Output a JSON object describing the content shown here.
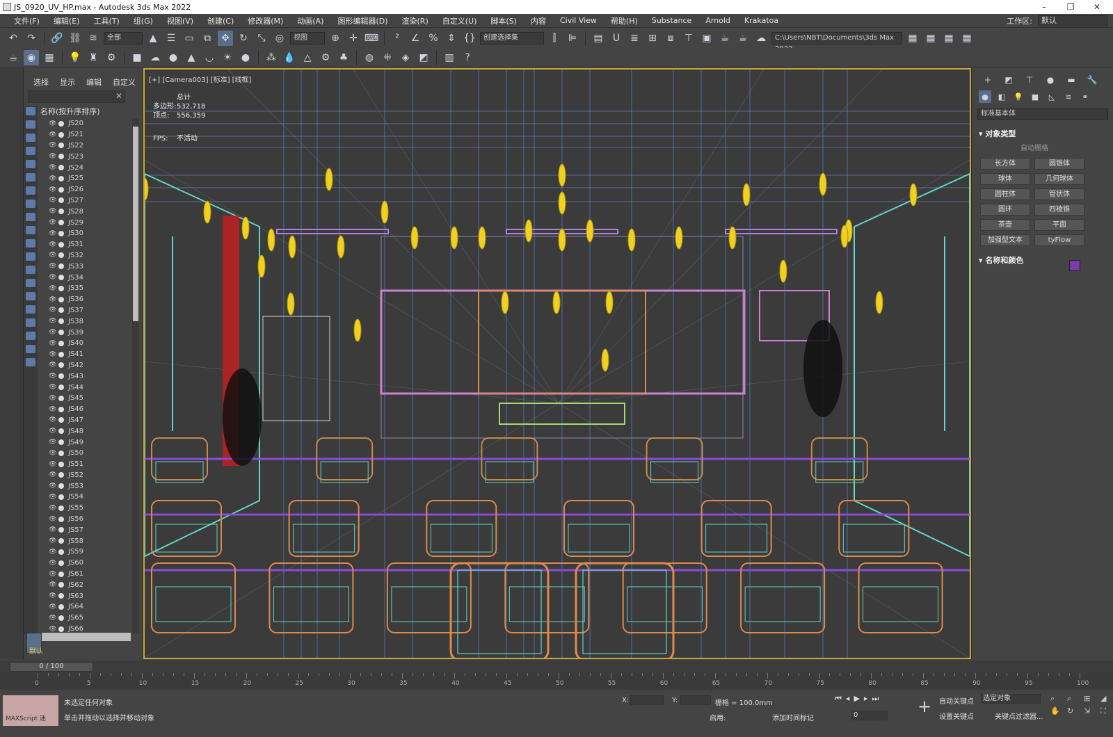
{
  "window": {
    "title": "JS_0920_UV_HP.max - Autodesk 3ds Max 2022",
    "controls": [
      "–",
      "❐",
      "✕"
    ]
  },
  "menubar": {
    "items": [
      "文件(F)",
      "编辑(E)",
      "工具(T)",
      "组(G)",
      "视图(V)",
      "创建(C)",
      "修改器(M)",
      "动画(A)",
      "图形编辑器(D)",
      "渲染(R)",
      "自定义(U)",
      "脚本(S)",
      "内容",
      "Civil View",
      "帮助(H)",
      "Substance",
      "Arnold",
      "Krakatoa"
    ],
    "workspace_label": "工作区:",
    "workspace_value": "默认"
  },
  "toolbar": {
    "filter_value": "全部",
    "viewref_value": "视图",
    "selset_value": "创建选择集",
    "path_value": "C:\\Users\\NBT\\Documents\\3ds Max 2022"
  },
  "scene_explorer": {
    "tabs": [
      "选择",
      "显示",
      "编辑",
      "自定义"
    ],
    "column_header": "名称(按升序排序)",
    "layer_label": "默认",
    "items": [
      "JS20",
      "JS21",
      "JS22",
      "JS23",
      "JS24",
      "JS25",
      "JS26",
      "JS27",
      "JS28",
      "JS29",
      "JS30",
      "JS31",
      "JS32",
      "JS33",
      "JS34",
      "JS35",
      "JS36",
      "JS37",
      "JS38",
      "JS39",
      "JS40",
      "JS41",
      "JS42",
      "JS43",
      "JS44",
      "JS45",
      "JS46",
      "JS47",
      "JS48",
      "JS49",
      "JS50",
      "JS51",
      "JS52",
      "JS53",
      "JS54",
      "JS55",
      "JS56",
      "JS57",
      "JS58",
      "JS59",
      "JS60",
      "JS61",
      "JS62",
      "JS63",
      "JS64",
      "JS65",
      "JS66"
    ]
  },
  "viewport": {
    "label": "[+] [Camera003] [标准] [线框]",
    "stats_title": "总计",
    "polys_label": "多边形:",
    "polys_value": "532,718",
    "verts_label": "顶点:",
    "verts_value": "556,359",
    "fps_label": "FPS:",
    "fps_value": "不活动",
    "colors": {
      "border": "#c8a83a",
      "cyan": "#5fd6c8",
      "orange": "#e08a4a",
      "purple": "#8a4ad6",
      "yellow": "#f0d020",
      "magenta": "#d080d0"
    }
  },
  "command_panel": {
    "category_dropdown": "标准基本体",
    "section_object_type": "▾ 对象类型",
    "autogrid_label": "自动栅格",
    "buttons": [
      "长方体",
      "圆锥体",
      "球体",
      "几何球体",
      "圆柱体",
      "管状体",
      "圆环",
      "四棱锥",
      "茶壶",
      "平面",
      "加强型文本",
      "tyFlow"
    ],
    "section_name_color": "▾ 名称和颜色",
    "object_color": "#7a3aa8"
  },
  "timeline": {
    "frame_display": "0 / 100",
    "ruler_labels": [
      "0",
      "5",
      "10",
      "15",
      "20",
      "25",
      "30",
      "35",
      "40",
      "45",
      "50",
      "55",
      "60",
      "65",
      "70",
      "75",
      "80",
      "85",
      "90",
      "95",
      "100"
    ]
  },
  "statusbar": {
    "maxscript_label": "MAXScript 迷",
    "message_line1": "未选定任何对象",
    "message_line2": "单击并拖动以选择并移动对象",
    "x_label": "X:",
    "y_label": "Y:",
    "z_label": "Z:",
    "grid_text": "栅格 = 100.0mm",
    "enable_label": "启用:",
    "add_time_tag": "添加时间标记",
    "frame_value": "0",
    "autokey_label": "自动关键点",
    "setkey_label": "设置关键点",
    "selected_obj": "选定对象",
    "key_filters": "关键点过滤器..."
  }
}
